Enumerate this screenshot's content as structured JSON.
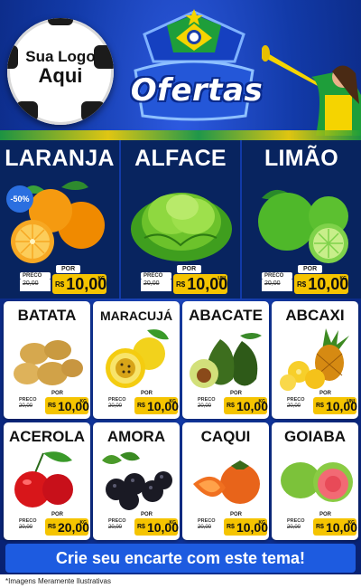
{
  "header": {
    "logo_line1": "Sua Logo",
    "logo_line2": "Aqui",
    "title": "Ofertas"
  },
  "top_products": [
    {
      "name": "LARANJA",
      "badge": "-50%",
      "old_label": "PRECO",
      "old_price": "20,00",
      "por": "POR",
      "currency": "R$",
      "price": "10,00",
      "unit": "KG"
    },
    {
      "name": "ALFACE",
      "old_label": "PRECO",
      "old_price": "20,00",
      "por": "POR",
      "currency": "R$",
      "price": "10,00",
      "unit": "UNI"
    },
    {
      "name": "LIMÃO",
      "old_label": "PRECO",
      "old_price": "20,00",
      "por": "POR",
      "currency": "R$",
      "price": "10,00",
      "unit": "KG"
    }
  ],
  "grid_products": [
    {
      "name": "BATATA",
      "old_label": "PRECO",
      "old_price": "20,00",
      "por": "POR",
      "currency": "R$",
      "price": "10,00",
      "unit": "KG"
    },
    {
      "name": "MARACUJÁ",
      "old_label": "PRECO",
      "old_price": "20,00",
      "por": "POR",
      "currency": "R$",
      "price": "10,00",
      "unit": "KG"
    },
    {
      "name": "ABACATE",
      "old_label": "PRECO",
      "old_price": "20,00",
      "por": "POR",
      "currency": "R$",
      "price": "10,00",
      "unit": "KG"
    },
    {
      "name": "ABCAXI",
      "old_label": "PRECO",
      "old_price": "20,00",
      "por": "POR",
      "currency": "R$",
      "price": "10,00",
      "unit": "UNI"
    },
    {
      "name": "ACEROLA",
      "old_label": "PRECO",
      "old_price": "20,00",
      "por": "POR",
      "currency": "R$",
      "price": "20,00",
      "unit": "KG"
    },
    {
      "name": "AMORA",
      "old_label": "PRECO",
      "old_price": "20,00",
      "por": "POR",
      "currency": "R$",
      "price": "10,00",
      "unit": "KG"
    },
    {
      "name": "CAQUI",
      "old_label": "PRECO",
      "old_price": "20,00",
      "por": "POR",
      "currency": "R$",
      "price": "10,00",
      "unit": "KG"
    },
    {
      "name": "GOIABA",
      "old_label": "PRECO",
      "old_price": "20,00",
      "por": "POR",
      "currency": "R$",
      "price": "10,00",
      "unit": "KG"
    }
  ],
  "cta": "Crie seu encarte com este tema!",
  "disclaimer": "*Imagens Meramente Ilustrativas",
  "colors": {
    "background": "#123aa8",
    "price_yellow": "#f5c400",
    "cta_blue": "#1d5be0"
  }
}
